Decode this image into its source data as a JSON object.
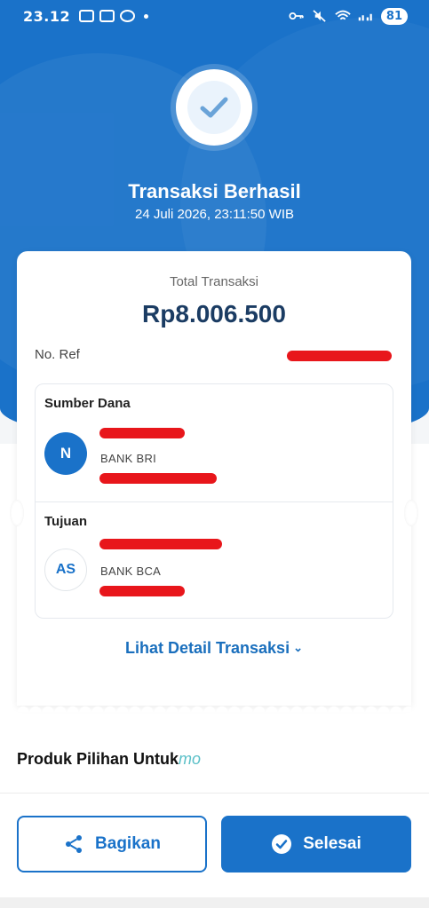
{
  "status_bar": {
    "time": "23.12",
    "battery": "81"
  },
  "header": {
    "title": "Transaksi Berhasil",
    "datetime": "24 Juli 2026, 23:11:50 WIB"
  },
  "receipt": {
    "total_label": "Total Transaksi",
    "total_amount": "Rp8.006.500",
    "ref_label": "No. Ref",
    "source": {
      "label": "Sumber Dana",
      "avatar_initial": "N",
      "bank": "BANK BRI"
    },
    "destination": {
      "label": "Tujuan",
      "avatar_initial": "AS",
      "bank": "BANK BCA"
    },
    "detail_link": "Lihat Detail Transaksi"
  },
  "recommend": {
    "title": "Produk Pilihan Untuk",
    "brand": "mo"
  },
  "actions": {
    "share_label": "Bagikan",
    "done_label": "Selesai"
  },
  "colors": {
    "primary": "#1a72c9",
    "amount": "#1b3c63",
    "redaction": "#e8161b"
  },
  "icons": [
    "wifi-icon",
    "mute-icon",
    "key-icon",
    "signal-icon",
    "check-icon",
    "share-icon",
    "check-circle-icon",
    "chevron-down-icon"
  ]
}
